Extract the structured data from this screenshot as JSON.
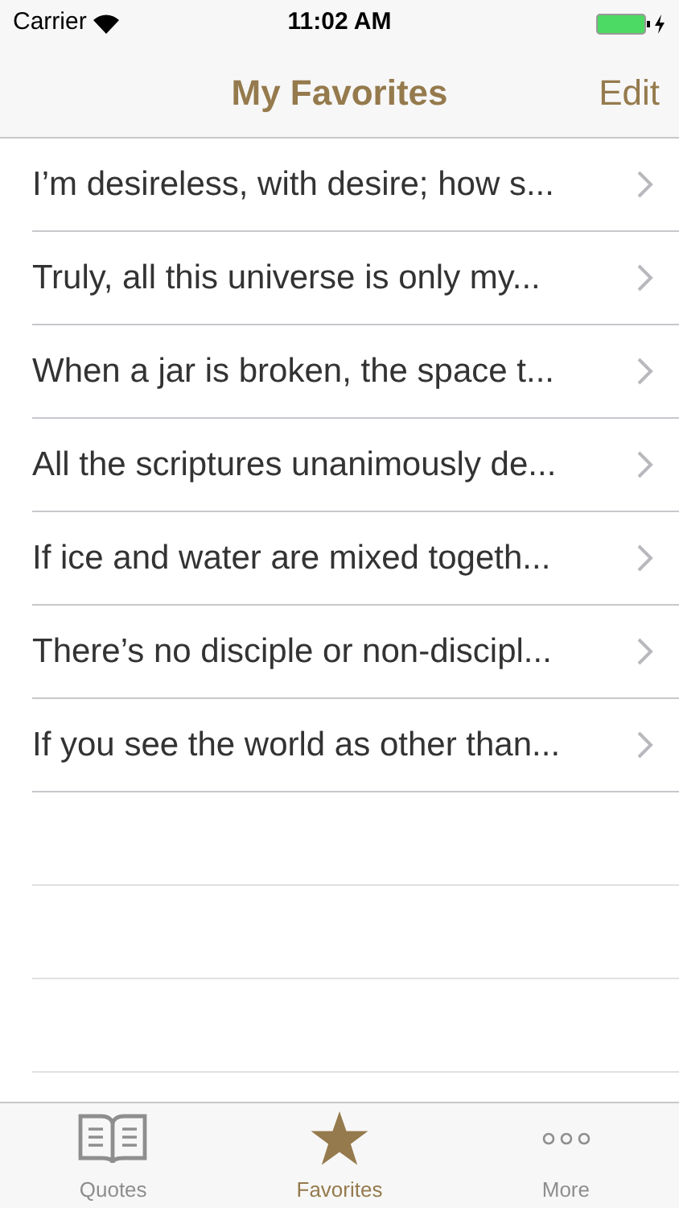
{
  "status_bar": {
    "carrier": "Carrier",
    "time": "11:02 AM"
  },
  "nav_bar": {
    "title": "My Favorites",
    "edit": "Edit"
  },
  "favorites": [
    {
      "text": "I’m desireless, with desire; how s..."
    },
    {
      "text": "Truly, all this universe is only my..."
    },
    {
      "text": "When a jar is broken, the space t..."
    },
    {
      "text": "All the scriptures unanimously de..."
    },
    {
      "text": "If ice and water are mixed togeth..."
    },
    {
      "text": "There’s no disciple or non-discipl..."
    },
    {
      "text": "If you see the world as other than..."
    }
  ],
  "tab_bar": [
    {
      "label": "Quotes",
      "kind": "book",
      "selected": false
    },
    {
      "label": "Favorites",
      "kind": "star",
      "selected": true
    },
    {
      "label": "More",
      "kind": "more",
      "selected": false
    }
  ]
}
